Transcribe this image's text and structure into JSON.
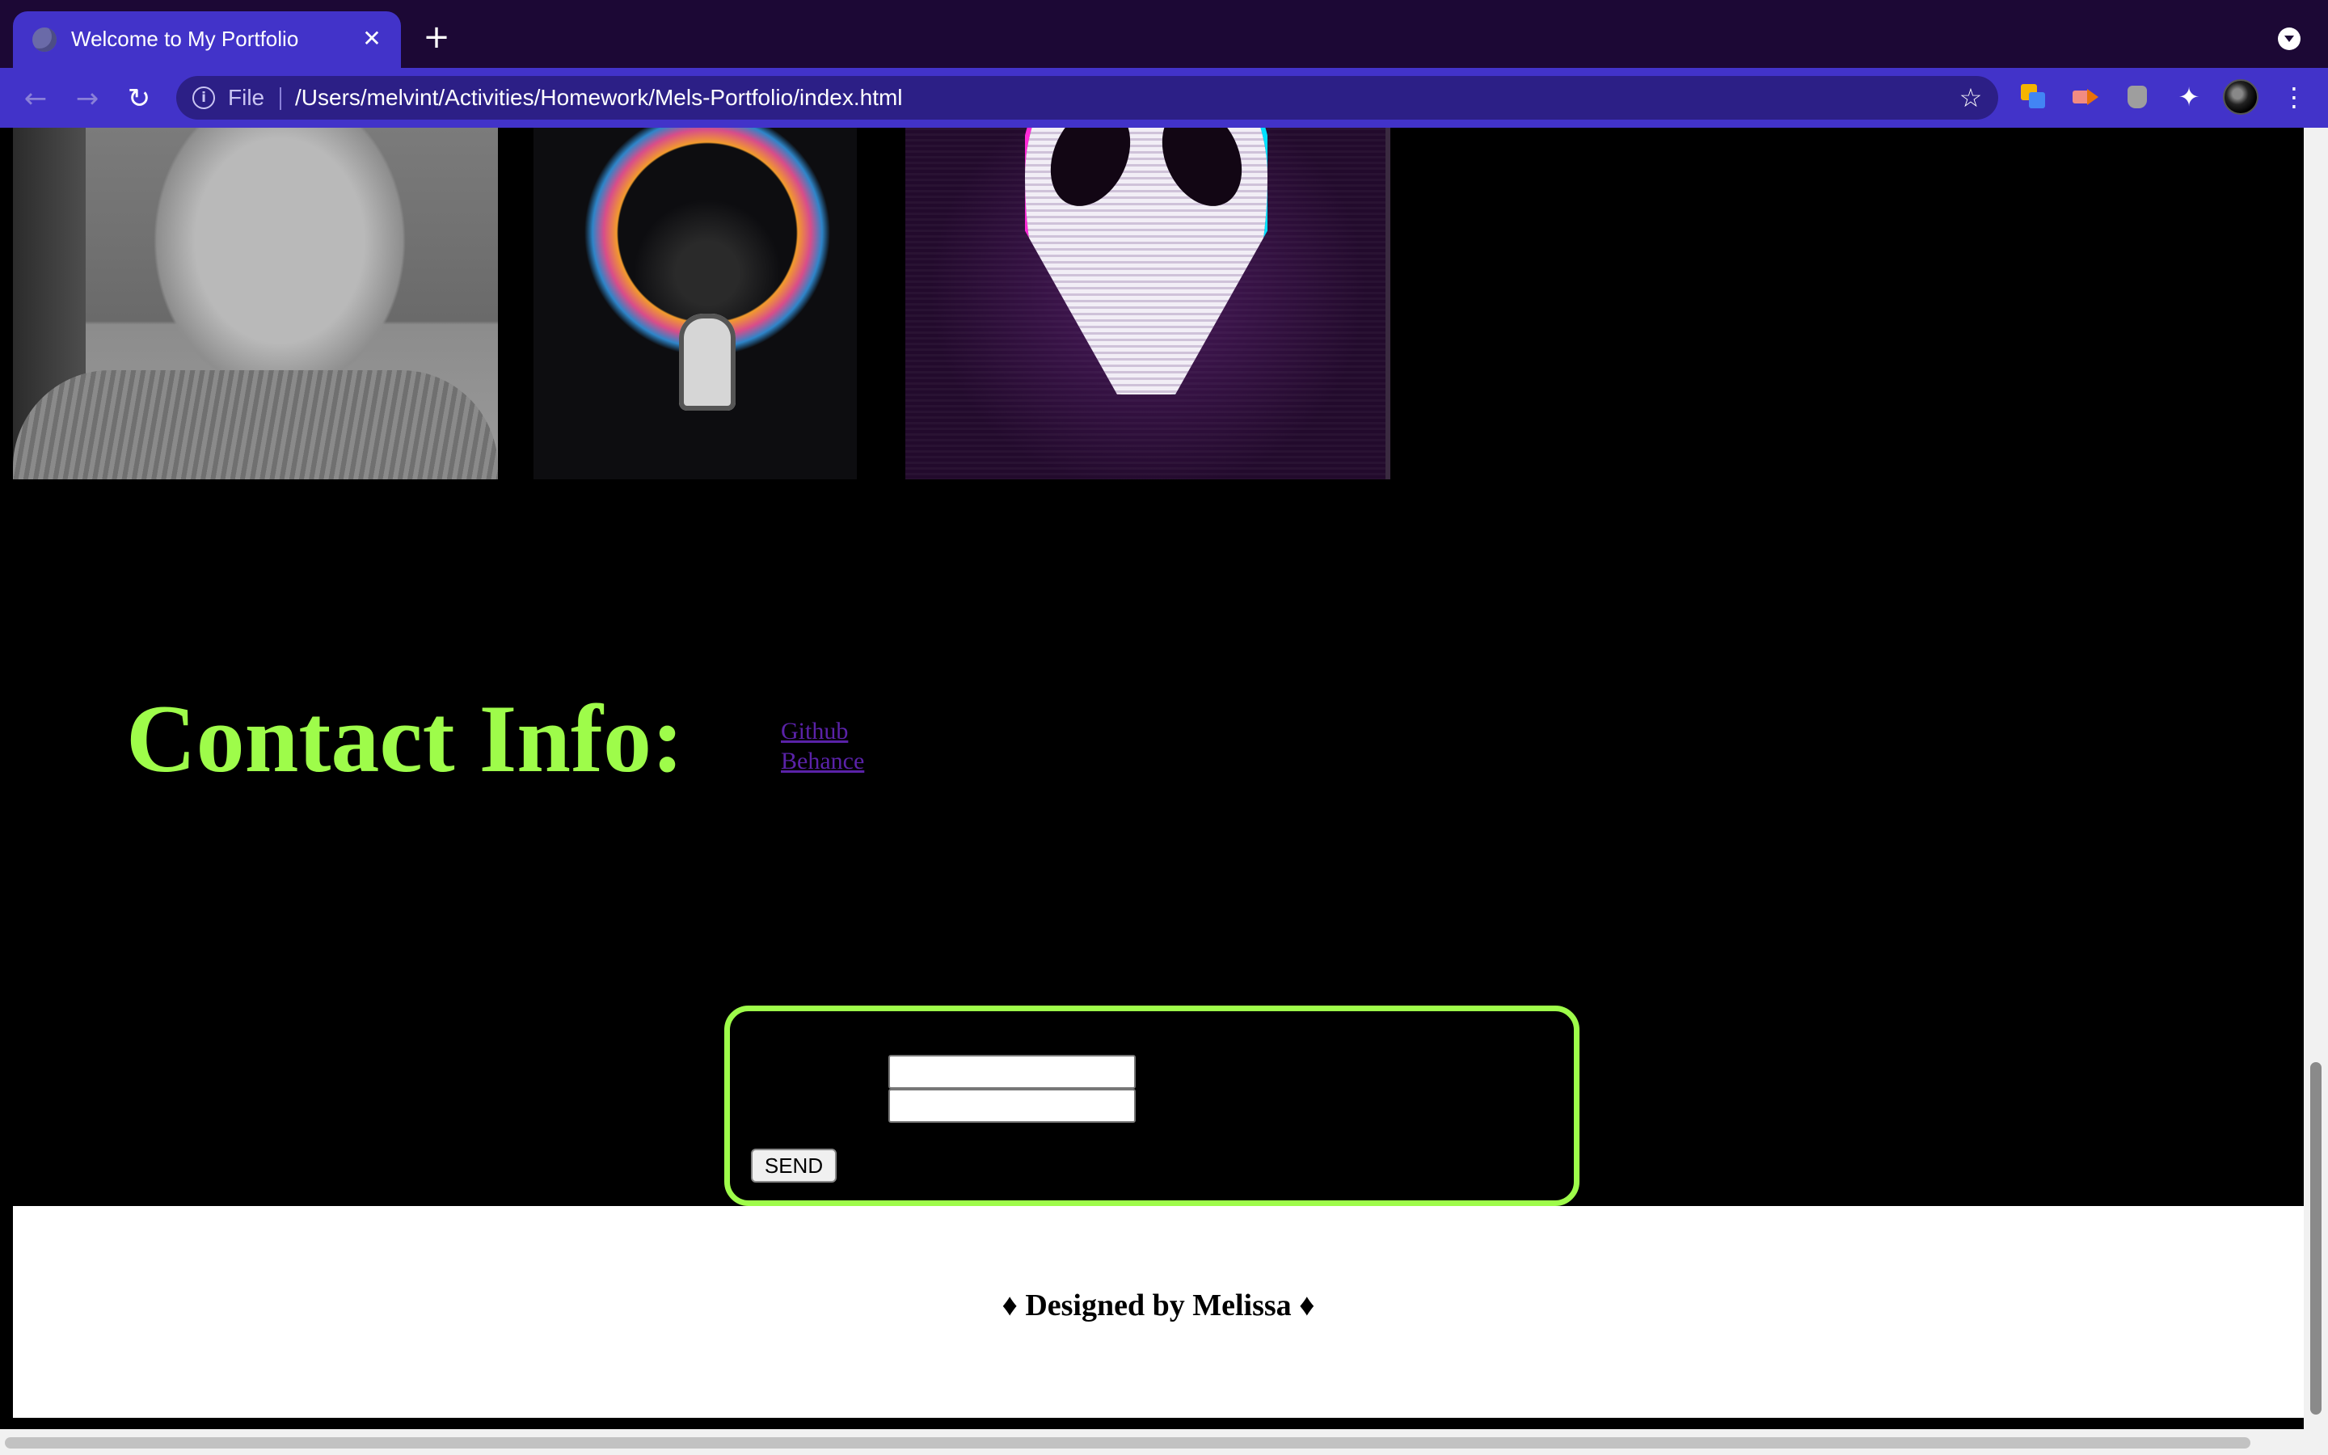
{
  "browser": {
    "tab_title": "Welcome to My Portfolio",
    "tab_close": "✕",
    "new_tab": "+",
    "back": "←",
    "forward": "→",
    "reload": "↻",
    "info": "i",
    "scheme_label": "File",
    "url": "/Users/melvint/Activities/Homework/Mels-Portfolio/index.html",
    "bookmark_star": "☆",
    "extensions_icon": "✦",
    "menu": "⋮",
    "colors": {
      "titlebar": "#1c0835",
      "toolbar": "#4233c9",
      "omnibox": "#2c1f86"
    }
  },
  "gallery": {
    "images": [
      {
        "name": "portrait-photo"
      },
      {
        "name": "astronaut-artwork"
      },
      {
        "name": "alien-artwork"
      }
    ]
  },
  "contact": {
    "title": "Contact Info:",
    "title_color": "#9efc4a",
    "links": [
      "Github",
      "Behance"
    ],
    "link_color": "#5a22a8"
  },
  "form": {
    "send_label": "SEND",
    "input_1_value": "",
    "input_2_value": "",
    "border_color": "#9efc4a"
  },
  "footer": {
    "text": "♦ Designed by Melissa ♦"
  }
}
